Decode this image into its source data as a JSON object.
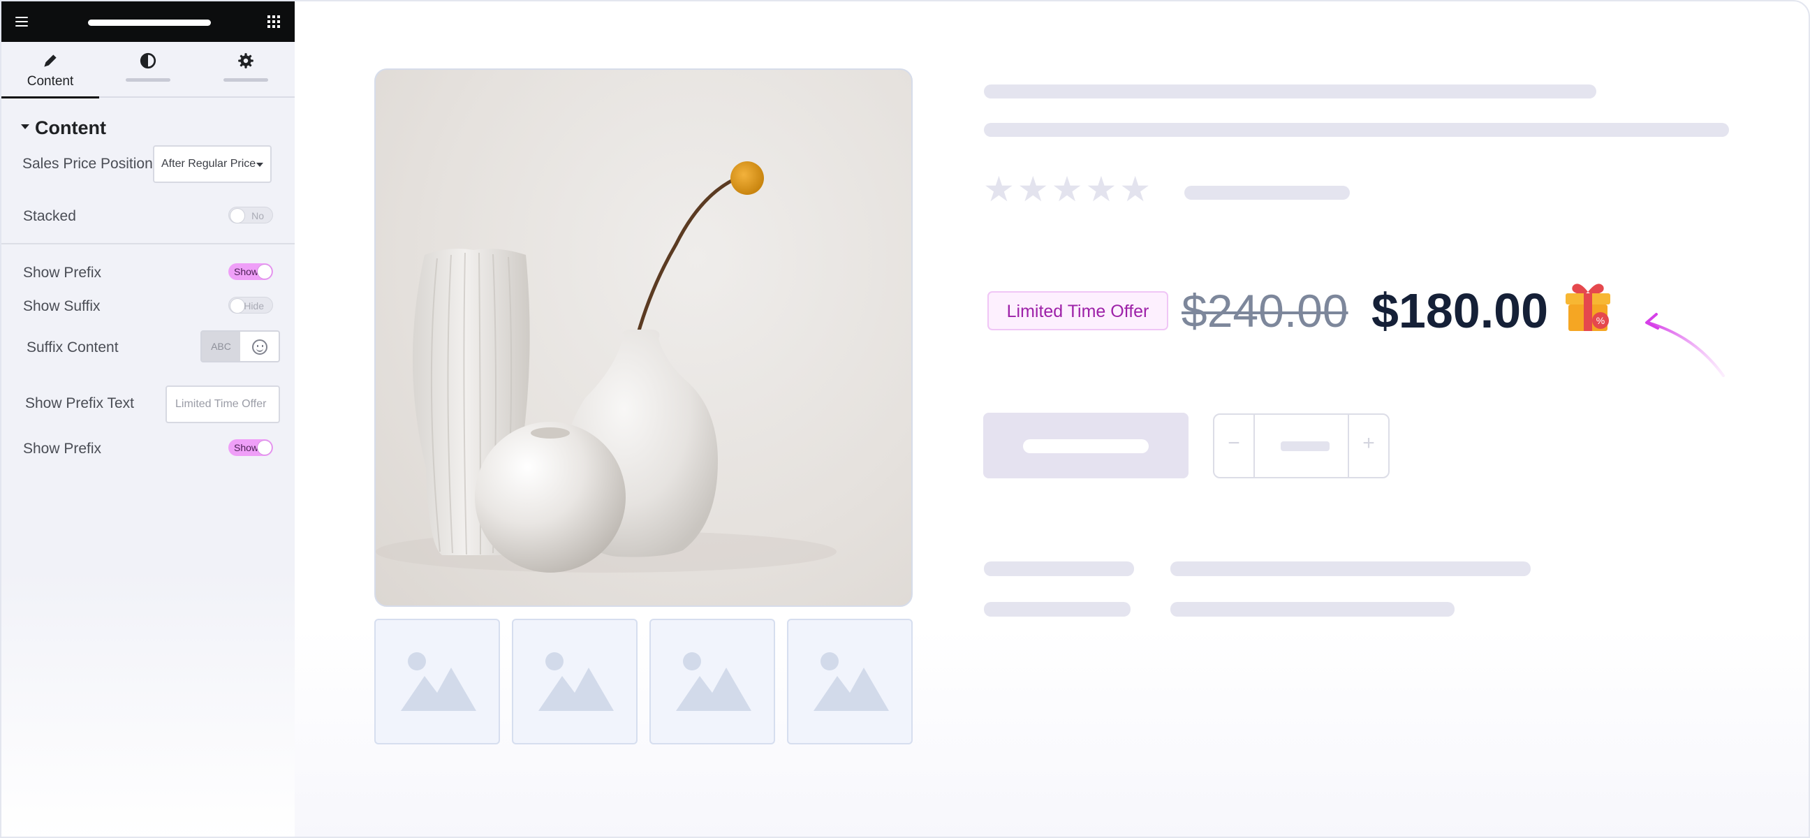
{
  "panel": {
    "tabs": [
      {
        "label": "Content",
        "icon": "pencil-icon",
        "active": true
      },
      {
        "label": "",
        "icon": "contrast-icon",
        "active": false
      },
      {
        "label": "",
        "icon": "gear-icon",
        "active": false
      }
    ],
    "section_title": "Content",
    "controls": {
      "sales_price_position": {
        "label": "Sales Price Position",
        "value": "After Regular Price"
      },
      "stacked": {
        "label": "Stacked",
        "state": "No"
      },
      "show_prefix": {
        "label": "Show Prefix",
        "state": "Show"
      },
      "show_suffix": {
        "label": "Show Suffix",
        "state": "Hide"
      },
      "suffix_content": {
        "label": "Suffix Content",
        "text_option": "ABC"
      },
      "show_prefix_text": {
        "label": "Show Prefix Text",
        "value": "Limited Time Offer"
      },
      "show_prefix_2": {
        "label": "Show Prefix",
        "state": "Show"
      }
    }
  },
  "preview": {
    "rating": "★★★★★",
    "prefix_badge": "Limited Time Offer",
    "regular_price": "$240.00",
    "sale_price": "$180.00",
    "quantity": {
      "minus": "−",
      "plus": "+"
    }
  },
  "colors": {
    "accent_pink": "#ef9ff8",
    "badge_text": "#9d21a8",
    "sale_price": "#152037",
    "regular_price": "#7d879b"
  }
}
